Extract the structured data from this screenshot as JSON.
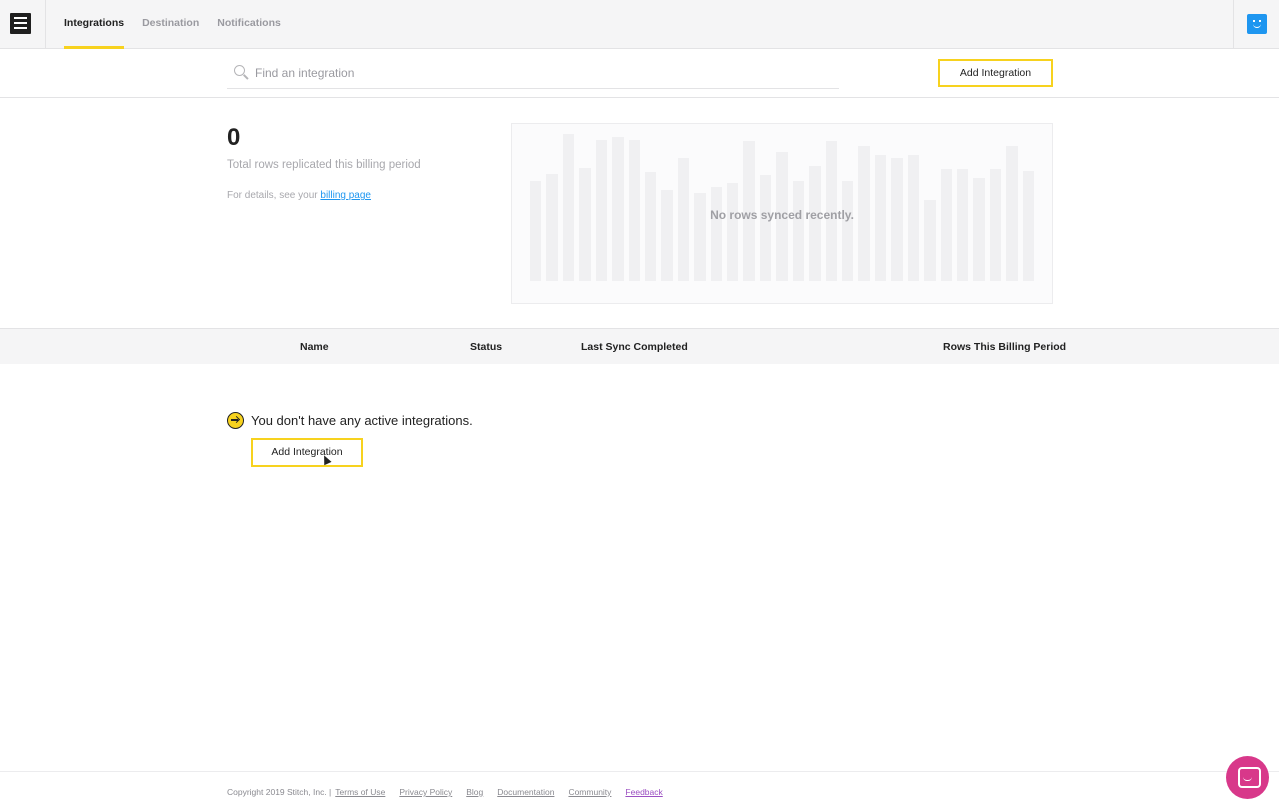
{
  "header": {
    "tabs": [
      {
        "label": "Integrations",
        "active": true
      },
      {
        "label": "Destination",
        "active": false
      },
      {
        "label": "Notifications",
        "active": false
      }
    ]
  },
  "search": {
    "placeholder": "Find an integration",
    "value": ""
  },
  "toolbar": {
    "add_integration_label": "Add Integration"
  },
  "stats": {
    "total_rows": "0",
    "label": "Total rows replicated this billing period",
    "details_prefix": "For details, see your",
    "billing_link": "billing page"
  },
  "chart": {
    "message": "No rows synced recently."
  },
  "table": {
    "columns": [
      "Name",
      "Status",
      "Last Sync Completed",
      "Rows This Billing Period"
    ]
  },
  "empty_state": {
    "message": "You don't have any active integrations.",
    "button_label": "Add Integration"
  },
  "footer": {
    "copyright": "Copyright 2019 Stitch, Inc. |",
    "links": [
      "Terms of Use",
      "Privacy Policy",
      "Blog",
      "Documentation",
      "Community",
      "Feedback"
    ]
  },
  "colors": {
    "accent": "#f7d21e",
    "link": "#1e96f0",
    "avatar": "#1e96f0",
    "chat": "#d8388a"
  }
}
